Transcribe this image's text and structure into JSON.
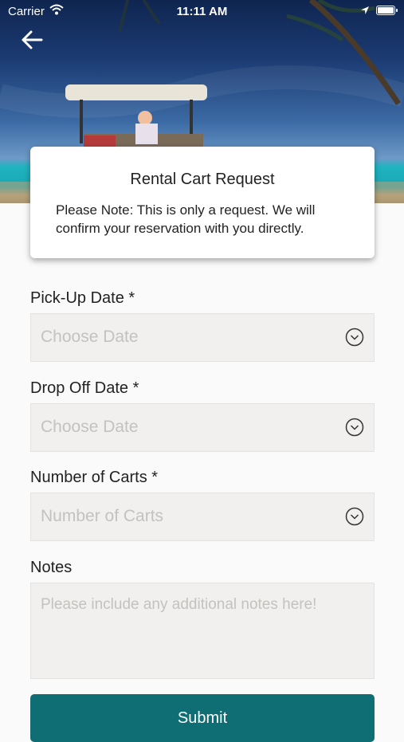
{
  "status_bar": {
    "carrier": "Carrier",
    "time": "11:11 AM"
  },
  "card": {
    "title": "Rental Cart Request",
    "note": "Please Note: This is only a request. We will confirm your reservation with you directly."
  },
  "form": {
    "pickup_label": "Pick-Up Date *",
    "pickup_placeholder": "Choose Date",
    "dropoff_label": "Drop Off Date *",
    "dropoff_placeholder": "Choose Date",
    "carts_label": "Number of Carts *",
    "carts_placeholder": "Number of Carts",
    "notes_label": "Notes",
    "notes_placeholder": "Please include any additional notes here!",
    "submit_label": "Submit"
  },
  "colors": {
    "accent": "#0e6e73",
    "field_bg": "#f1f0ee",
    "placeholder": "#c4c2bf"
  },
  "icons": [
    "back-arrow-icon",
    "wifi-icon",
    "location-icon",
    "battery-icon",
    "chevron-down-icon"
  ]
}
